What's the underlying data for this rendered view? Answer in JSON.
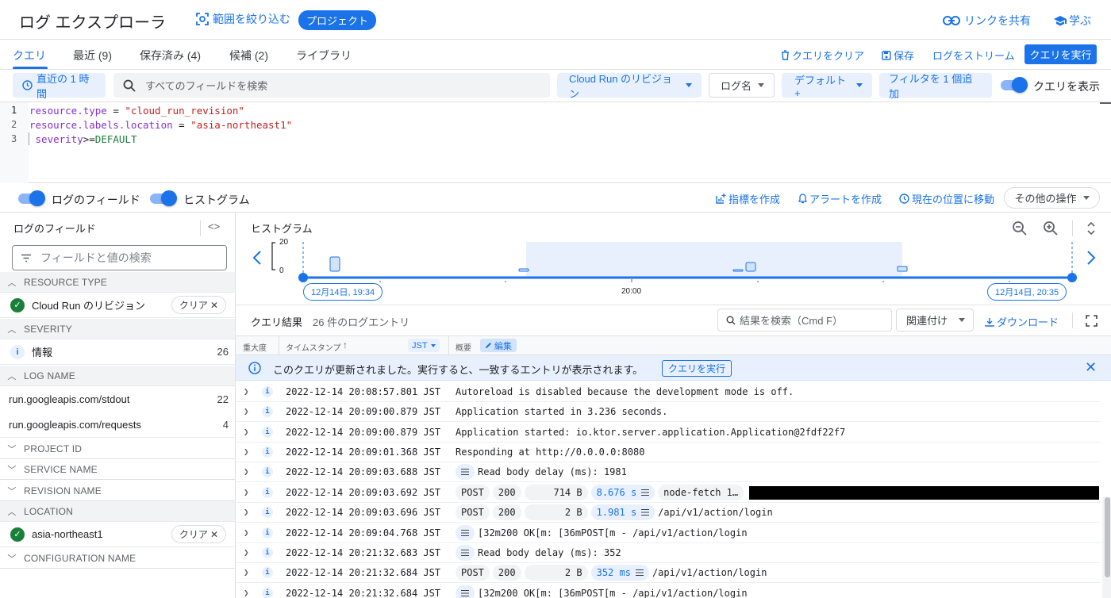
{
  "header": {
    "title": "ログ エクスプローラ",
    "narrow_scope": "範囲を絞り込む",
    "project_chip": "プロジェクト",
    "share_link": "リンクを共有",
    "learn": "学ぶ"
  },
  "tabs": {
    "items": [
      "クエリ",
      "最近 (9)",
      "保存済み (4)",
      "候補 (2)",
      "ライブラリ"
    ],
    "active_index": 0,
    "clear_query": "クエリをクリア",
    "save": "保存",
    "stream": "ログをストリーム",
    "run_query": "クエリを実行"
  },
  "filters": {
    "time_range": "直近の 1 時間",
    "search_placeholder": "すべてのフィールドを検索",
    "resource": "Cloud Run のリビジョン",
    "log_name": "ログ名",
    "severity": "デフォルト+",
    "add_filter": "フィルタを 1 個追加",
    "show_query_label": "クエリを表示",
    "show_query_on": true
  },
  "editor": {
    "lines": [
      {
        "n": "1",
        "key": "resource.type",
        "op": " = ",
        "val": "\"cloud_run_revision\""
      },
      {
        "n": "2",
        "key": "resource.labels.location",
        "op": " = ",
        "val": "\"asia-northeast1\""
      },
      {
        "n": "3",
        "key": " severity",
        "op": ">=",
        "val": "DEFAULT"
      }
    ]
  },
  "view_toggles": {
    "log_fields": "ログのフィールド",
    "histogram": "ヒストグラム",
    "create_metric": "指標を作成",
    "create_alert": "アラートを作成",
    "jump_now": "現在の位置に移動",
    "more_actions": "その他の操作"
  },
  "log_fields": {
    "title": "ログのフィールド",
    "search_placeholder": "フィールドと値の検索",
    "clear_label": "クリア",
    "sections": {
      "resource_type": "RESOURCE TYPE",
      "resource_type_value": "Cloud Run のリビジョン",
      "severity": "SEVERITY",
      "severity_value": "情報",
      "severity_count": "26",
      "log_name": "LOG NAME",
      "log_name_values": [
        {
          "name": "run.googleapis.com/stdout",
          "count": "22"
        },
        {
          "name": "run.googleapis.com/requests",
          "count": "4"
        }
      ],
      "project_id": "PROJECT ID",
      "service_name": "SERVICE NAME",
      "revision_name": "REVISION NAME",
      "location": "LOCATION",
      "location_value": "asia-northeast1",
      "configuration_name": "CONFIGURATION NAME"
    }
  },
  "histogram": {
    "title": "ヒストグラム",
    "y_max": "20",
    "y_min": "0",
    "start_label": "12月14日, 19:34",
    "mid_label": "20:00",
    "end_label": "12月14日, 20:35"
  },
  "results": {
    "title": "クエリ結果",
    "count": "26 件のログエントリ",
    "search_placeholder": "結果を検索（Cmd F）",
    "relate": "関連付け",
    "download": "ダウンロード",
    "columns": {
      "severity": "重大度",
      "timestamp": "タイムスタンプ",
      "tz": "JST",
      "summary": "概要",
      "edit": "編集"
    },
    "banner": {
      "text": "このクエリが更新されました。実行すると、一致するエントリが表示されます。",
      "run": "クエリを実行"
    },
    "rows": [
      {
        "ts": "2022-12-14 20:08:57.801 JST",
        "text": "Autoreload is disabled because the development mode is off."
      },
      {
        "ts": "2022-12-14 20:09:00.879 JST",
        "text": "Application started in 3.236 seconds."
      },
      {
        "ts": "2022-12-14 20:09:00.879 JST",
        "text": "Application started: io.ktor.server.application.Application@2fdf22f7"
      },
      {
        "ts": "2022-12-14 20:09:01.368 JST",
        "text": "Responding at http://0.0.0.0:8080"
      },
      {
        "ts": "2022-12-14 20:09:03.688 JST",
        "text": "Read body delay (ms): 1981"
      },
      {
        "ts": "2022-12-14 20:09:03.692 JST",
        "method": "POST",
        "status": "200",
        "size": "714 B",
        "latency": "8.676 s",
        "agent": "node-fetch 1…"
      },
      {
        "ts": "2022-12-14 20:09:03.696 JST",
        "method": "POST",
        "status": "200",
        "size": "2 B",
        "latency": "1.981 s",
        "path": "/api/v1/action/login"
      },
      {
        "ts": "2022-12-14 20:09:04.768 JST",
        "text": "[32m200 OK[m: [36mPOST[m - /api/v1/action/login"
      },
      {
        "ts": "2022-12-14 20:21:32.683 JST",
        "text": "Read body delay (ms): 352"
      },
      {
        "ts": "2022-12-14 20:21:32.684 JST",
        "method": "POST",
        "status": "200",
        "size": "2 B",
        "latency": "352 ms",
        "path": "/api/v1/action/login"
      },
      {
        "ts": "2022-12-14 20:21:32.684 JST",
        "text": "[32m200 OK[m: [36mPOST[m - /api/v1/action/login"
      }
    ]
  }
}
